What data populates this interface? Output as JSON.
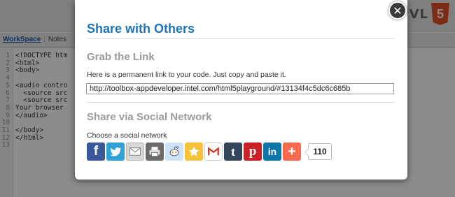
{
  "background": {
    "logo_text": "VL",
    "logo_badge": "5",
    "tabs": [
      "WorkSpace",
      "Notes"
    ],
    "code_lines": [
      {
        "num": "1",
        "text": "<!DOCTYPE htm"
      },
      {
        "num": "2",
        "text": "<html>"
      },
      {
        "num": "3",
        "text": "<body>"
      },
      {
        "num": "4",
        "text": ""
      },
      {
        "num": "5",
        "text": "<audio contro"
      },
      {
        "num": "6",
        "text": "  <source src"
      },
      {
        "num": "7",
        "text": "  <source src"
      },
      {
        "num": "8",
        "text": "Your browser"
      },
      {
        "num": "9",
        "text": "</audio>"
      },
      {
        "num": "10",
        "text": ""
      },
      {
        "num": "11",
        "text": "</body>"
      },
      {
        "num": "12",
        "text": "</html>"
      },
      {
        "num": "13",
        "text": ""
      }
    ]
  },
  "modal": {
    "title": "Share with Others",
    "grab": {
      "heading": "Grab the Link",
      "description": "Here is a permanent link to your code. Just copy and paste it.",
      "link": "http://toolbox-appdeveloper.intel.com/html5playground/#13134f4c5dc6c685b"
    },
    "social": {
      "heading": "Share via Social Network",
      "subtext": "Choose a social network",
      "count": "110",
      "buttons": [
        {
          "icon": "facebook-icon",
          "color": "#3b5998"
        },
        {
          "icon": "twitter-icon",
          "color": "#2ea2d8"
        },
        {
          "icon": "email-icon",
          "color": "#d8d8d8"
        },
        {
          "icon": "print-icon",
          "color": "#6b6b6b"
        },
        {
          "icon": "reddit-icon",
          "color": "#cee3f8"
        },
        {
          "icon": "favorites-icon",
          "color": "#f5c33b"
        },
        {
          "icon": "gmail-icon",
          "color": "#ffffff"
        },
        {
          "icon": "tumblr-icon",
          "color": "#35465c"
        },
        {
          "icon": "pinterest-icon",
          "color": "#cb2027"
        },
        {
          "icon": "linkedin-icon",
          "color": "#0e76a8"
        },
        {
          "icon": "more-icon",
          "color": "#f8694d"
        }
      ]
    }
  },
  "close_icon": "close-icon"
}
